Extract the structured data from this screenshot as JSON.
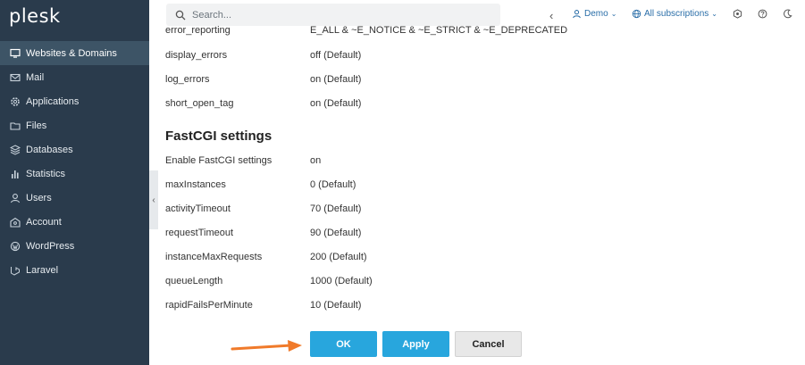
{
  "app": {
    "logo": "plesk"
  },
  "sidebar": {
    "items": [
      {
        "label": "Websites & Domains",
        "icon": "monitor-icon",
        "active": true
      },
      {
        "label": "Mail",
        "icon": "mail-icon"
      },
      {
        "label": "Applications",
        "icon": "gear-icon"
      },
      {
        "label": "Files",
        "icon": "folder-icon"
      },
      {
        "label": "Databases",
        "icon": "database-icon"
      },
      {
        "label": "Statistics",
        "icon": "bar-chart-icon"
      },
      {
        "label": "Users",
        "icon": "user-icon"
      },
      {
        "label": "Account",
        "icon": "account-icon"
      },
      {
        "label": "WordPress",
        "icon": "wordpress-icon"
      },
      {
        "label": "Laravel",
        "icon": "laravel-icon"
      }
    ]
  },
  "header": {
    "search_placeholder": "Search...",
    "user": "Demo",
    "subscriptions": "All subscriptions",
    "accent": "#2a6ea8"
  },
  "php_settings": [
    {
      "name": "error_reporting",
      "value": "E_ALL & ~E_NOTICE & ~E_STRICT & ~E_DEPRECATED"
    },
    {
      "name": "display_errors",
      "value": "off (Default)"
    },
    {
      "name": "log_errors",
      "value": "on (Default)"
    },
    {
      "name": "short_open_tag",
      "value": "on (Default)"
    }
  ],
  "fastcgi": {
    "title": "FastCGI settings",
    "settings": [
      {
        "name": "Enable FastCGI settings",
        "value": "on"
      },
      {
        "name": "maxInstances",
        "value": "0 (Default)"
      },
      {
        "name": "activityTimeout",
        "value": "70 (Default)"
      },
      {
        "name": "requestTimeout",
        "value": "90 (Default)"
      },
      {
        "name": "instanceMaxRequests",
        "value": "200 (Default)"
      },
      {
        "name": "queueLength",
        "value": "1000 (Default)"
      },
      {
        "name": "rapidFailsPerMinute",
        "value": "10 (Default)"
      }
    ]
  },
  "buttons": {
    "ok": "OK",
    "apply": "Apply",
    "cancel": "Cancel"
  },
  "colors": {
    "sidebar": "#2a3b4c",
    "sidebar_active": "#3d5466",
    "primary_button": "#28a6dd",
    "arrow": "#f07a2a"
  }
}
